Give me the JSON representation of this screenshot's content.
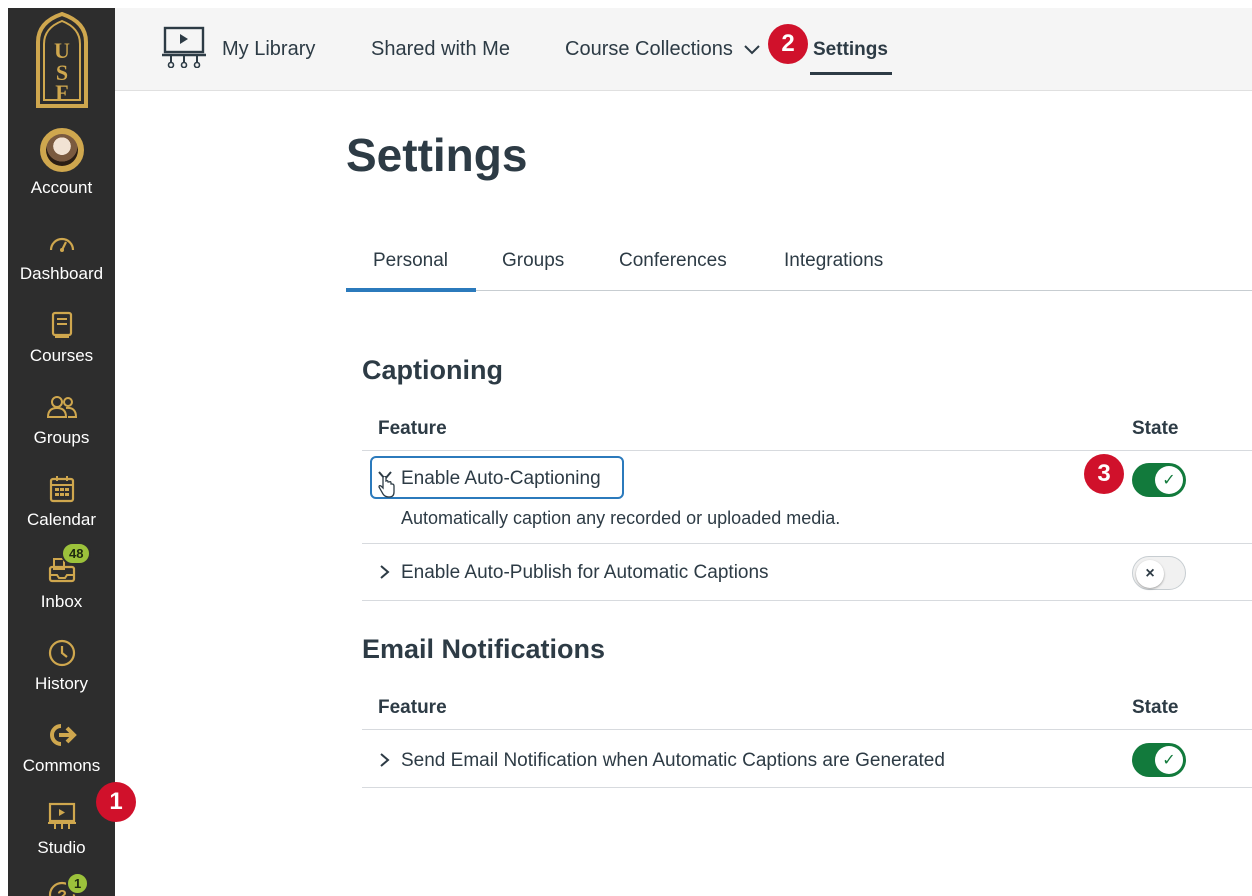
{
  "global_nav": {
    "logo_letters": "USF",
    "items": [
      {
        "label": "Account"
      },
      {
        "label": "Dashboard"
      },
      {
        "label": "Courses"
      },
      {
        "label": "Groups"
      },
      {
        "label": "Calendar"
      },
      {
        "label": "Inbox",
        "badge": "48"
      },
      {
        "label": "History"
      },
      {
        "label": "Commons"
      },
      {
        "label": "Studio"
      }
    ],
    "help_badge": "1"
  },
  "topbar": {
    "my_library": "My Library",
    "shared_with_me": "Shared with Me",
    "course_collections": "Course Collections",
    "settings": "Settings"
  },
  "callouts": {
    "one": "1",
    "two": "2",
    "three": "3"
  },
  "page": {
    "title": "Settings",
    "tabs": [
      {
        "label": "Personal"
      },
      {
        "label": "Groups"
      },
      {
        "label": "Conferences"
      },
      {
        "label": "Integrations"
      }
    ]
  },
  "captioning": {
    "title": "Captioning",
    "col_feature": "Feature",
    "col_state": "State",
    "rows": [
      {
        "label": "Enable Auto-Captioning",
        "description": "Automatically caption any recorded or uploaded media.",
        "state": "on"
      },
      {
        "label": "Enable Auto-Publish for Automatic Captions",
        "state": "off"
      }
    ]
  },
  "email": {
    "title": "Email Notifications",
    "col_feature": "Feature",
    "col_state": "State",
    "rows": [
      {
        "label": "Send Email Notification when Automatic Captions are Generated",
        "state": "on"
      }
    ]
  },
  "icons": {
    "toggle_on": "✓",
    "toggle_off": "×",
    "chevron_right": "›",
    "chevron_down": "⌄"
  },
  "colors": {
    "nav_bg": "#2d2d2d",
    "brand_gold": "#cfa74e",
    "toggle_on": "#127a3c",
    "callout_red": "#d0112b",
    "tab_active": "#2b7abc"
  }
}
